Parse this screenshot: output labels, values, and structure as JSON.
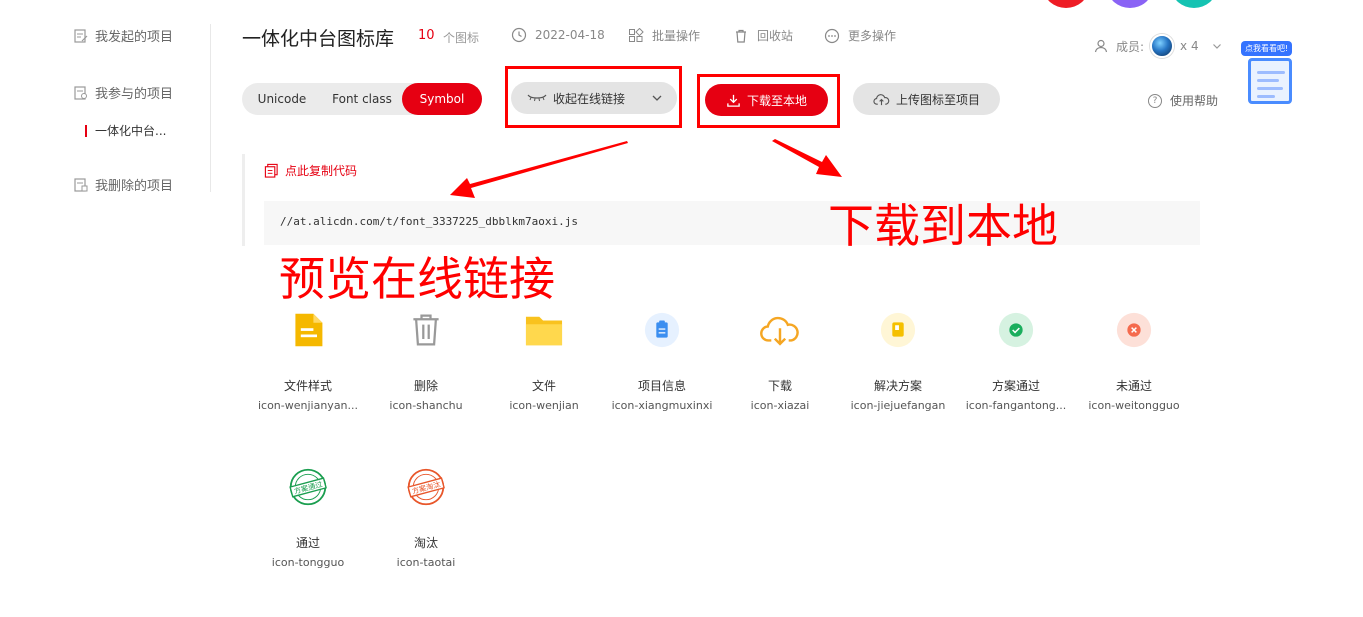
{
  "sidebar": {
    "items": [
      {
        "label": "我发起的项目"
      },
      {
        "label": "我参与的项目"
      },
      {
        "label": "我删除的项目"
      }
    ],
    "sub_item": "一体化中台..."
  },
  "header": {
    "title": "一体化中台图标库",
    "icon_count": "10",
    "icon_count_unit": "个图标",
    "date": "2022-04-18",
    "batch_label": "批量操作",
    "recycle_label": "回收站",
    "more_label": "更多操作",
    "members_label": "成员:",
    "members_count": "x 4",
    "help_label": "使用帮助"
  },
  "mascot": {
    "bubble": "点我看看吧!"
  },
  "tabs": [
    {
      "label": "Unicode",
      "active": false
    },
    {
      "label": "Font class",
      "active": false
    },
    {
      "label": "Symbol",
      "active": true
    }
  ],
  "actions": {
    "collapse_label": "收起在线链接",
    "download_label": "下载至本地",
    "upload_label": "上传图标至项目"
  },
  "code": {
    "copy_label": "点此复制代码",
    "url": "//at.alicdn.com/t/font_3337225_dbblkm7aoxi.js"
  },
  "annotations": {
    "download": "下载到本地",
    "preview": "预览在线链接"
  },
  "icons": [
    {
      "name": "文件样式",
      "code": "icon-wenjianyangshi",
      "code_display": "icon-wenjianyan...",
      "icon": "document-icon",
      "color": "#f5b800"
    },
    {
      "name": "删除",
      "code": "icon-shanchu",
      "icon": "trash-icon",
      "color": "#999999"
    },
    {
      "name": "文件",
      "code": "icon-wenjian",
      "icon": "folder-icon",
      "color": "#f9c21e"
    },
    {
      "name": "项目信息",
      "code": "icon-xiangmuxinxi",
      "icon": "clipboard-icon",
      "color": "#3b8ef0"
    },
    {
      "name": "下载",
      "code": "icon-xiazai",
      "icon": "cloud-download-icon",
      "color": "#f5a623"
    },
    {
      "name": "解决方案",
      "code": "icon-jiejuefangan",
      "icon": "solution-icon",
      "color": "#f5c000"
    },
    {
      "name": "方案通过",
      "code": "icon-fangantongguo",
      "code_display": "icon-fangantong...",
      "icon": "check-circle-icon",
      "color": "#1aae5d"
    },
    {
      "name": "未通过",
      "code": "icon-weitongguo",
      "icon": "x-circle-icon",
      "color": "#f56a4d"
    },
    {
      "name": "通过",
      "code": "icon-tongguo",
      "icon": "approved-stamp-icon",
      "color": "#1a9e4f",
      "stamp": "方案通过"
    },
    {
      "name": "淘汰",
      "code": "icon-taotai",
      "icon": "rejected-stamp-icon",
      "color": "#e8562a",
      "stamp": "方案淘汰"
    }
  ]
}
